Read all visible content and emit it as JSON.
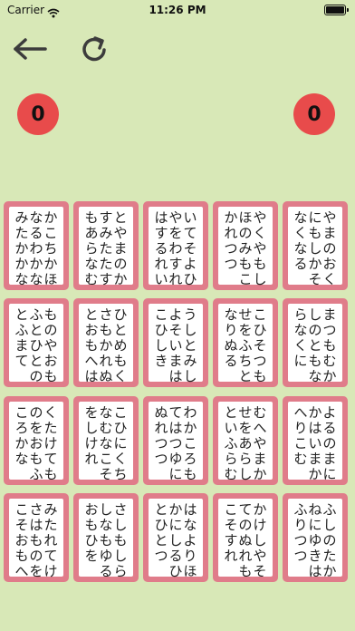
{
  "status": {
    "carrier": "Carrier",
    "time": "11:26 PM"
  },
  "toolbar": {
    "back_icon": "arrow-left-icon",
    "reload_icon": "reload-icon"
  },
  "scores": {
    "left": "0",
    "right": "0"
  },
  "colors": {
    "background": "#d8e8b7",
    "score": "#e84b4b",
    "card_border": "#e07c8a"
  },
  "cards": [
    [
      "かこちかほ",
      "なるわかな",
      "みたかかな"
    ],
    [
      "とやまのか",
      "すみたたす",
      "もあらなむ"
    ],
    [
      "いてそよひ",
      "やをわすれ",
      "はするれい"
    ],
    [
      "やくやもし",
      "ほのみもこ",
      "かれつつ"
    ],
    [
      "やまのおく",
      "にもしかそ",
      "なくなる"
    ],
    [
      "ものやおも",
      "ふとひとの",
      "とふまて"
    ],
    [
      "ひとめもく",
      "さもかれぬ",
      "とおもへは"
    ],
    [
      "うしとみし",
      "よそいまは",
      "こひしき"
    ],
    [
      "こひそつも",
      "せをふちと",
      "なりぬる"
    ],
    [
      "まつもむか",
      "しのともな",
      "らなくに"
    ],
    [
      "くたけても",
      "のをおもふ",
      "ころかな"
    ],
    [
      "こひにくち",
      "なむなこそ",
      "をしけれ"
    ],
    [
      "わかころも",
      "てはつゆに",
      "ぬれつつ"
    ],
    [
      "むへやまか",
      "せをあらし",
      "といふらむ"
    ],
    [
      "よるのまに",
      "かはいまか",
      "へりこむ"
    ],
    [
      "みたれてけ",
      "さはものを",
      "こそおもへ"
    ],
    [
      "さしもしら",
      "しなもゆる",
      "おもひを"
    ],
    [
      "はなよりほ",
      "かにしるひ",
      "とひとつ"
    ],
    [
      "かけしやそ",
      "てのぬれも",
      "こそすれ"
    ],
    [
      "ふしのたか",
      "ねにゆきは",
      "ふりつつ"
    ]
  ]
}
